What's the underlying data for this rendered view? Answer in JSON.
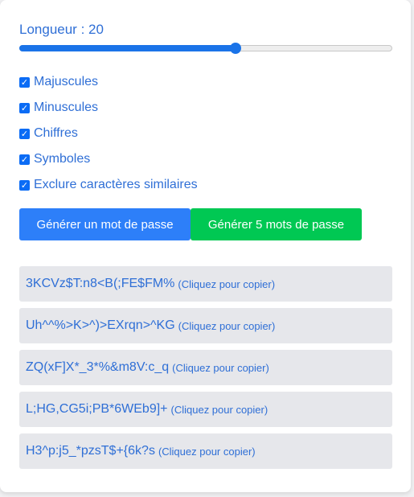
{
  "length": {
    "label": "Longueur : 20",
    "value": 20,
    "fill_fraction": 0.58
  },
  "options": [
    {
      "label": "Majuscules",
      "checked": true
    },
    {
      "label": "Minuscules",
      "checked": true
    },
    {
      "label": "Chiffres",
      "checked": true
    },
    {
      "label": "Symboles",
      "checked": true
    },
    {
      "label": "Exclure caractères similaires",
      "checked": true
    }
  ],
  "buttons": {
    "generate_one": "Générer un mot de passe",
    "generate_five": "Générer 5 mots de passe"
  },
  "results": [
    {
      "password": "3KCVz$T:n8<B(;FE$FM%",
      "hint": "(Cliquez pour copier)"
    },
    {
      "password": "Uh^^%>K>^)>EXrqn>^KG",
      "hint": "(Cliquez pour copier)"
    },
    {
      "password": "ZQ(xF]X*_3*%&m8V:c_q",
      "hint": "(Cliquez pour copier)"
    },
    {
      "password": "L;HG,CG5i;PB*6WEb9]+",
      "hint": "(Cliquez pour copier)"
    },
    {
      "password": "H3^p:j5_*pzsT$+{6k?s",
      "hint": "(Cliquez pour copier)"
    }
  ],
  "colors": {
    "text_blue": "#2f6fd6",
    "primary_blue": "#2d7ff9",
    "success_green": "#00c853",
    "result_bg": "#e6e7eb"
  },
  "icons": {
    "checkbox": "check-icon"
  }
}
